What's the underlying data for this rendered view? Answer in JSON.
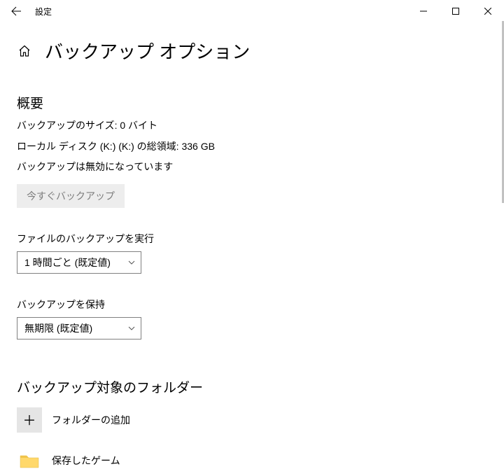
{
  "window": {
    "title": "設定"
  },
  "page": {
    "title": "バックアップ オプション"
  },
  "overview": {
    "heading": "概要",
    "size_line": "バックアップのサイズ: 0 バイト",
    "disk_line": "ローカル ディスク (K:) (K:) の総領域: 336 GB",
    "status_line": "バックアップは無効になっています",
    "backup_now_label": "今すぐバックアップ"
  },
  "frequency": {
    "label": "ファイルのバックアップを実行",
    "selected": "1 時間ごと (既定値)"
  },
  "retention": {
    "label": "バックアップを保持",
    "selected": "無期限 (既定値)"
  },
  "folders": {
    "heading": "バックアップ対象のフォルダー",
    "add_label": "フォルダーの追加",
    "items": [
      {
        "label": "保存したゲーム"
      }
    ]
  }
}
